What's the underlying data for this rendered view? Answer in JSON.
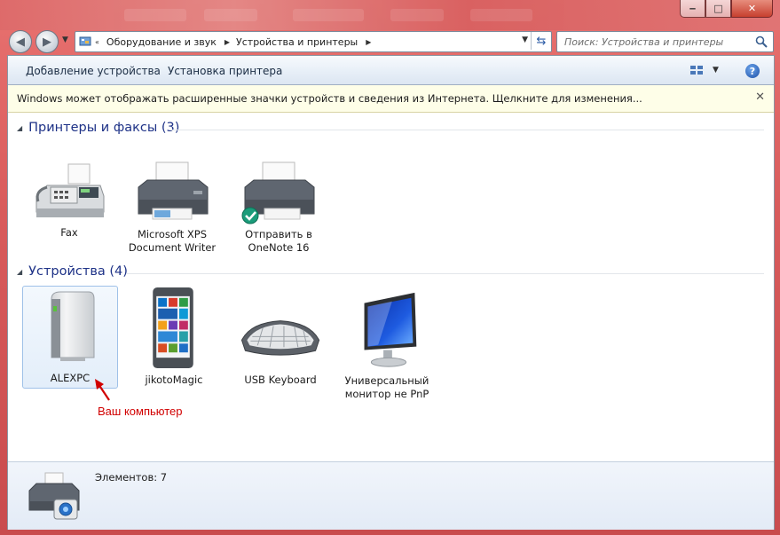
{
  "window": {
    "minimize": "‒",
    "maximize": "□",
    "close": "✕"
  },
  "address": {
    "root_chevron": "«",
    "crumbs": [
      "Оборудование и звук",
      "Устройства и принтеры"
    ],
    "search_placeholder": "Поиск: Устройства и принтеры"
  },
  "toolbar": {
    "add_device": "Добавление устройства",
    "install_printer": "Установка принтера",
    "help": "?"
  },
  "infobar": {
    "text": "Windows может отображать расширенные значки устройств и сведения из Интернета.  Щелкните для изменения...",
    "close": "✕"
  },
  "groups": {
    "printers": {
      "title": "Принтеры и факсы (3)",
      "items": [
        {
          "label": "Fax",
          "icon": "fax-icon"
        },
        {
          "label": "Microsoft XPS Document Writer",
          "icon": "printer-icon"
        },
        {
          "label": "Отправить в OneNote 16",
          "icon": "printer-default-icon"
        }
      ]
    },
    "devices": {
      "title": "Устройства (4)",
      "items": [
        {
          "label": "ALEXPC",
          "icon": "computer-icon"
        },
        {
          "label": "jikotoMagic",
          "icon": "phone-icon"
        },
        {
          "label": "USB Keyboard",
          "icon": "keyboard-icon"
        },
        {
          "label": "Универсальный монитор не PnP",
          "icon": "monitor-icon"
        }
      ]
    }
  },
  "annotation": {
    "text": "Ваш компьютер",
    "color": "#d10000"
  },
  "details": {
    "count_text": "Элементов: 7"
  },
  "colors": {
    "frame": "#d85b5c",
    "group_title": "#1e3287",
    "infobar": "#fefee8"
  }
}
